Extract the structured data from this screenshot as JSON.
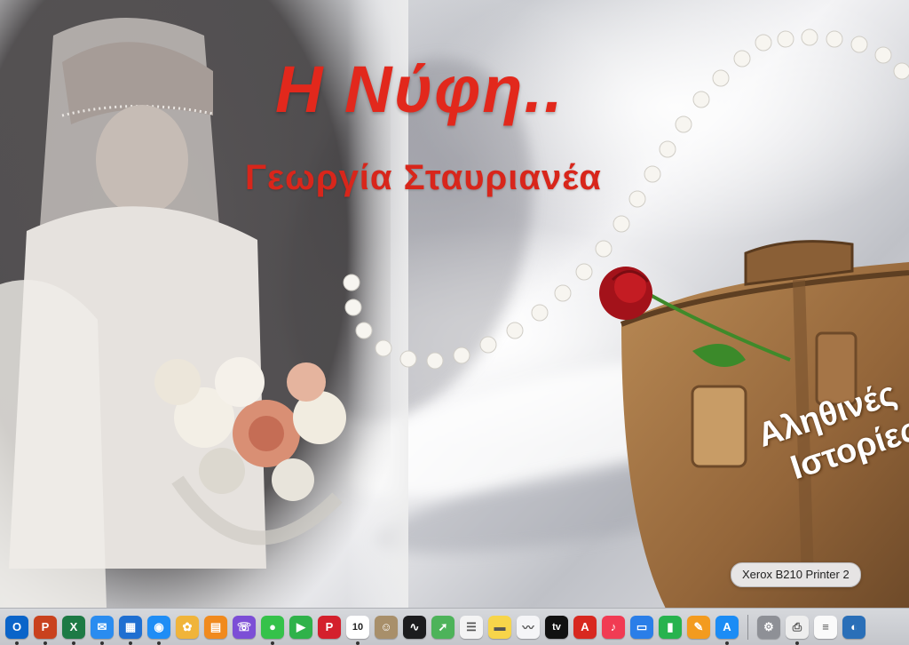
{
  "cover": {
    "title": "Η Νύφη..",
    "author": "Γεωργία Σταυριανέα",
    "stamp_line1": "Αληθινές",
    "stamp_line2": "Ιστορίες"
  },
  "tooltip": {
    "text": "Xerox B210 Printer 2"
  },
  "dock": {
    "apps": [
      {
        "id": "outlook",
        "glyph": "O",
        "color": "#0a64c9"
      },
      {
        "id": "powerpoint",
        "glyph": "P",
        "color": "#c9421e"
      },
      {
        "id": "excel",
        "glyph": "X",
        "color": "#1d7a45"
      },
      {
        "id": "mail",
        "glyph": "✉",
        "color": "#2a8cf0"
      },
      {
        "id": "outlook-calendar",
        "glyph": "▦",
        "color": "#1f6fd1"
      },
      {
        "id": "messenger",
        "glyph": "◉",
        "color": "#1f8df5"
      },
      {
        "id": "photos",
        "glyph": "✿",
        "color": "#f0b43a"
      },
      {
        "id": "books",
        "glyph": "▤",
        "color": "#f08a1e"
      },
      {
        "id": "viber",
        "glyph": "☏",
        "color": "#7c4ed6"
      },
      {
        "id": "messages",
        "glyph": "●",
        "color": "#35c24a"
      },
      {
        "id": "facetime",
        "glyph": "▶",
        "color": "#2fb24a"
      },
      {
        "id": "pinterest",
        "glyph": "P",
        "color": "#d4202c"
      },
      {
        "id": "calendar",
        "glyph": "10",
        "color": "#ffffff"
      },
      {
        "id": "contacts",
        "glyph": "☺",
        "color": "#a88f6a"
      },
      {
        "id": "voice-memos",
        "glyph": "∿",
        "color": "#1c1c1e"
      },
      {
        "id": "maps",
        "glyph": "➚",
        "color": "#4db35a"
      },
      {
        "id": "reminders",
        "glyph": "☰",
        "color": "#f4f4f4"
      },
      {
        "id": "notes",
        "glyph": "▬",
        "color": "#f7d54a"
      },
      {
        "id": "freeform",
        "glyph": "〰",
        "color": "#f5f5f7"
      },
      {
        "id": "apple-tv",
        "glyph": "tv",
        "color": "#111111"
      },
      {
        "id": "adobe-acrobat",
        "glyph": "A",
        "color": "#d8281f"
      },
      {
        "id": "music",
        "glyph": "♪",
        "color": "#f13b53"
      },
      {
        "id": "keynote",
        "glyph": "▭",
        "color": "#2a7ee8"
      },
      {
        "id": "numbers",
        "glyph": "▮",
        "color": "#27b34e"
      },
      {
        "id": "pages",
        "glyph": "✎",
        "color": "#f39b1f"
      },
      {
        "id": "app-store",
        "glyph": "A",
        "color": "#1b8cf5"
      },
      {
        "id": "system-settings",
        "glyph": "⚙",
        "color": "#8e9096"
      },
      {
        "id": "printer",
        "glyph": "⎙",
        "color": "#eeeeee"
      },
      {
        "id": "document",
        "glyph": "≡",
        "color": "#fafafa"
      },
      {
        "id": "finder-window",
        "glyph": "◐",
        "color": "#2a6fb8"
      }
    ]
  }
}
